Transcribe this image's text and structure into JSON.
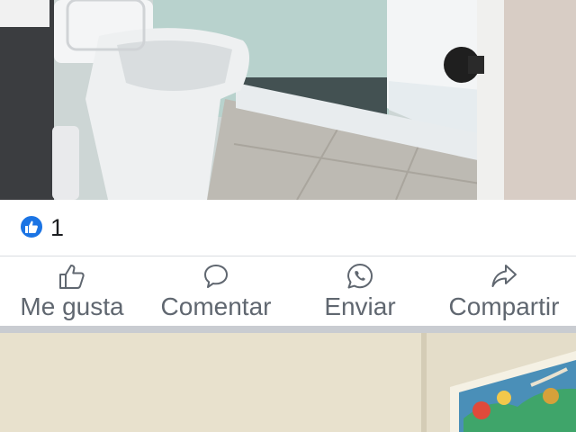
{
  "post": {
    "photo_top_name": "bathroom-photo",
    "reaction_count": "1",
    "actions": {
      "like": "Me gusta",
      "comment": "Comentar",
      "send": "Enviar",
      "share": "Compartir"
    }
  },
  "next_post": {
    "photo_name": "wall-painting-photo"
  },
  "icons": {
    "reaction": "thumbs-up-icon",
    "like": "thumbs-up-outline-icon",
    "comment": "speech-bubble-icon",
    "send": "whatsapp-icon",
    "share": "share-arrow-icon"
  },
  "colors": {
    "like_badge": "#1b74e4",
    "action_text": "#606770",
    "count_text": "#1c1e21",
    "separator": "#c9ccd1"
  }
}
